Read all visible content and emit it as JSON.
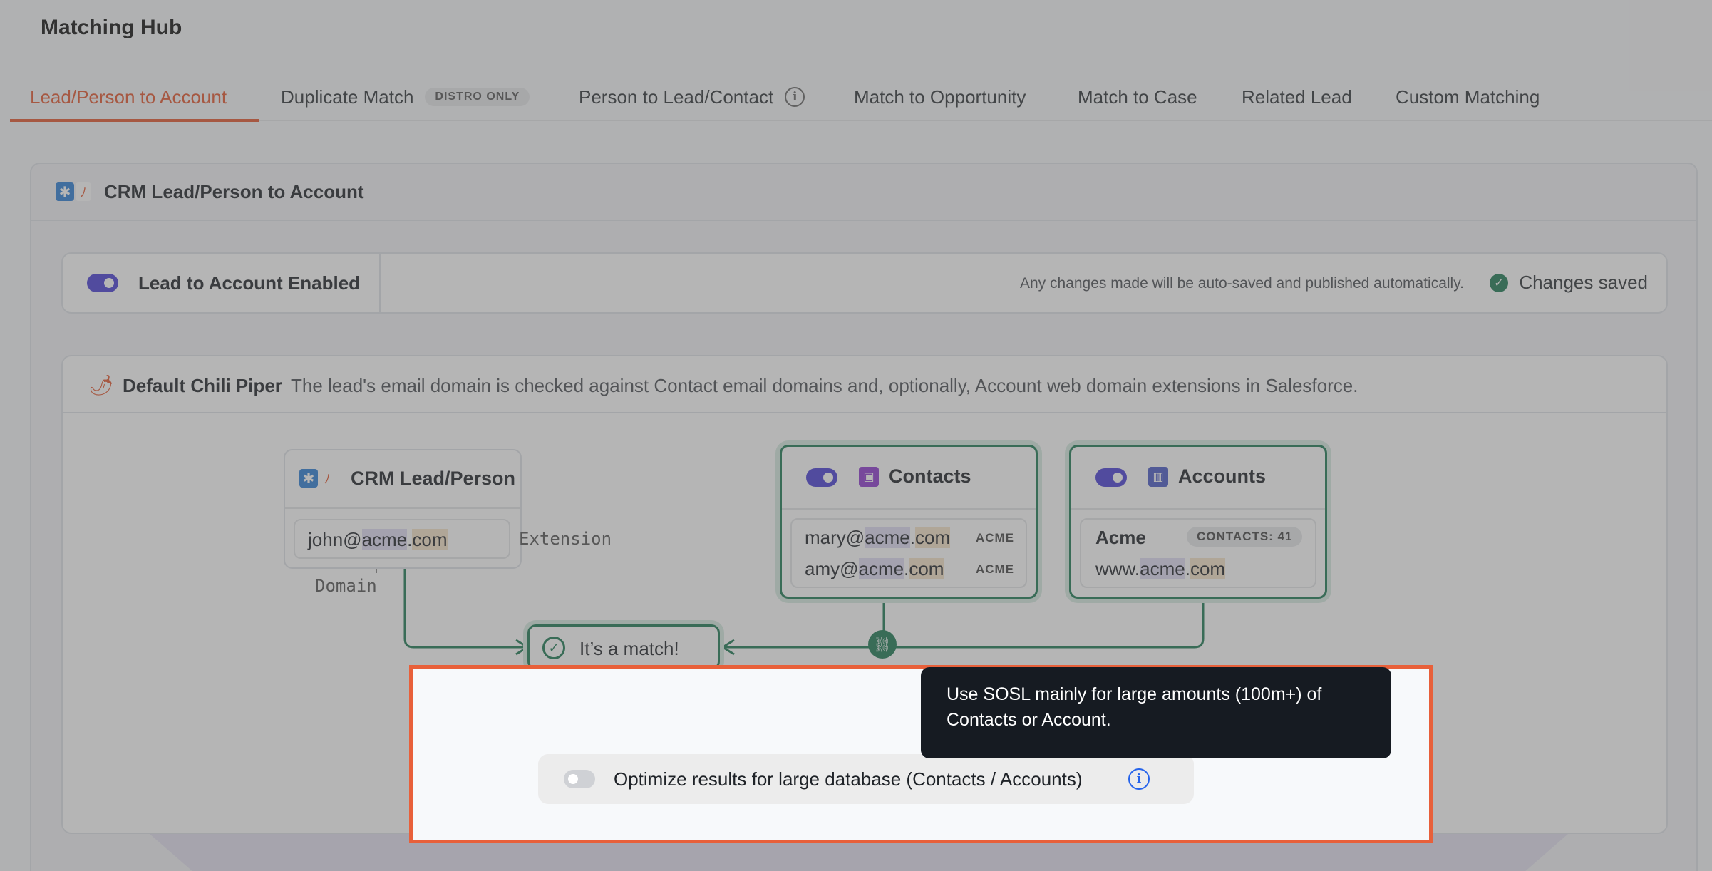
{
  "app": {
    "title": "Matching Hub"
  },
  "tabs": [
    {
      "label": "Lead/Person to Account",
      "active": true
    },
    {
      "label": "Duplicate Match",
      "badge": "DISTRO ONLY"
    },
    {
      "label": "Person to Lead/Contact",
      "info": "i"
    },
    {
      "label": "Match to Opportunity"
    },
    {
      "label": "Match to Case"
    },
    {
      "label": "Related Lead"
    },
    {
      "label": "Custom Matching"
    }
  ],
  "panel": {
    "title": "CRM Lead/Person to Account"
  },
  "enable_bar": {
    "label": "Lead to Account Enabled",
    "enabled": true,
    "autosave_note": "Any changes made will be auto-saved and published automatically.",
    "saved_label": "Changes saved"
  },
  "default": {
    "title": "Default Chili Piper",
    "description": "The lead's email domain is checked against Contact email domains and, optionally, Account web domain extensions in Salesforce."
  },
  "diagram": {
    "lead": {
      "title": "CRM Lead/Person",
      "email_user": "john@",
      "email_domain": "acme",
      "email_dot": ".",
      "email_ext": "com",
      "domain_label": "Domain",
      "extension_label": "Extension"
    },
    "contacts": {
      "title": "Contacts",
      "enabled": true,
      "rows": [
        {
          "user": "mary@",
          "domain": "acme",
          "dot": ".",
          "ext": "com",
          "tag": "ACME"
        },
        {
          "user": "amy@",
          "domain": "acme",
          "dot": ".",
          "ext": "com",
          "tag": "ACME"
        }
      ]
    },
    "accounts": {
      "title": "Accounts",
      "enabled": true,
      "name": "Acme",
      "contacts_badge": "CONTACTS: 41",
      "web_prefix": "www.",
      "web_domain": "acme",
      "web_dot": ".",
      "web_ext": "com"
    },
    "match_label": "It’s a match!"
  },
  "optimize": {
    "label": "Optimize results for large database (Contacts / Accounts)",
    "enabled": false,
    "info": "i",
    "tooltip": "Use SOSL mainly for large amounts (100m+) of Contacts or Account."
  },
  "colors": {
    "accent": "#e4572e",
    "toggle_on": "#4a3fd6",
    "match_green": "#1e7a54",
    "highlight_border": "#e8603a"
  },
  "icons": {
    "logo_sf": "✱",
    "logo_cp": "ﾉ",
    "chili": "🌶",
    "saved_check": "✓",
    "match_check": "✓",
    "link": "⛓",
    "contacts": "▣",
    "accounts": "▥"
  }
}
